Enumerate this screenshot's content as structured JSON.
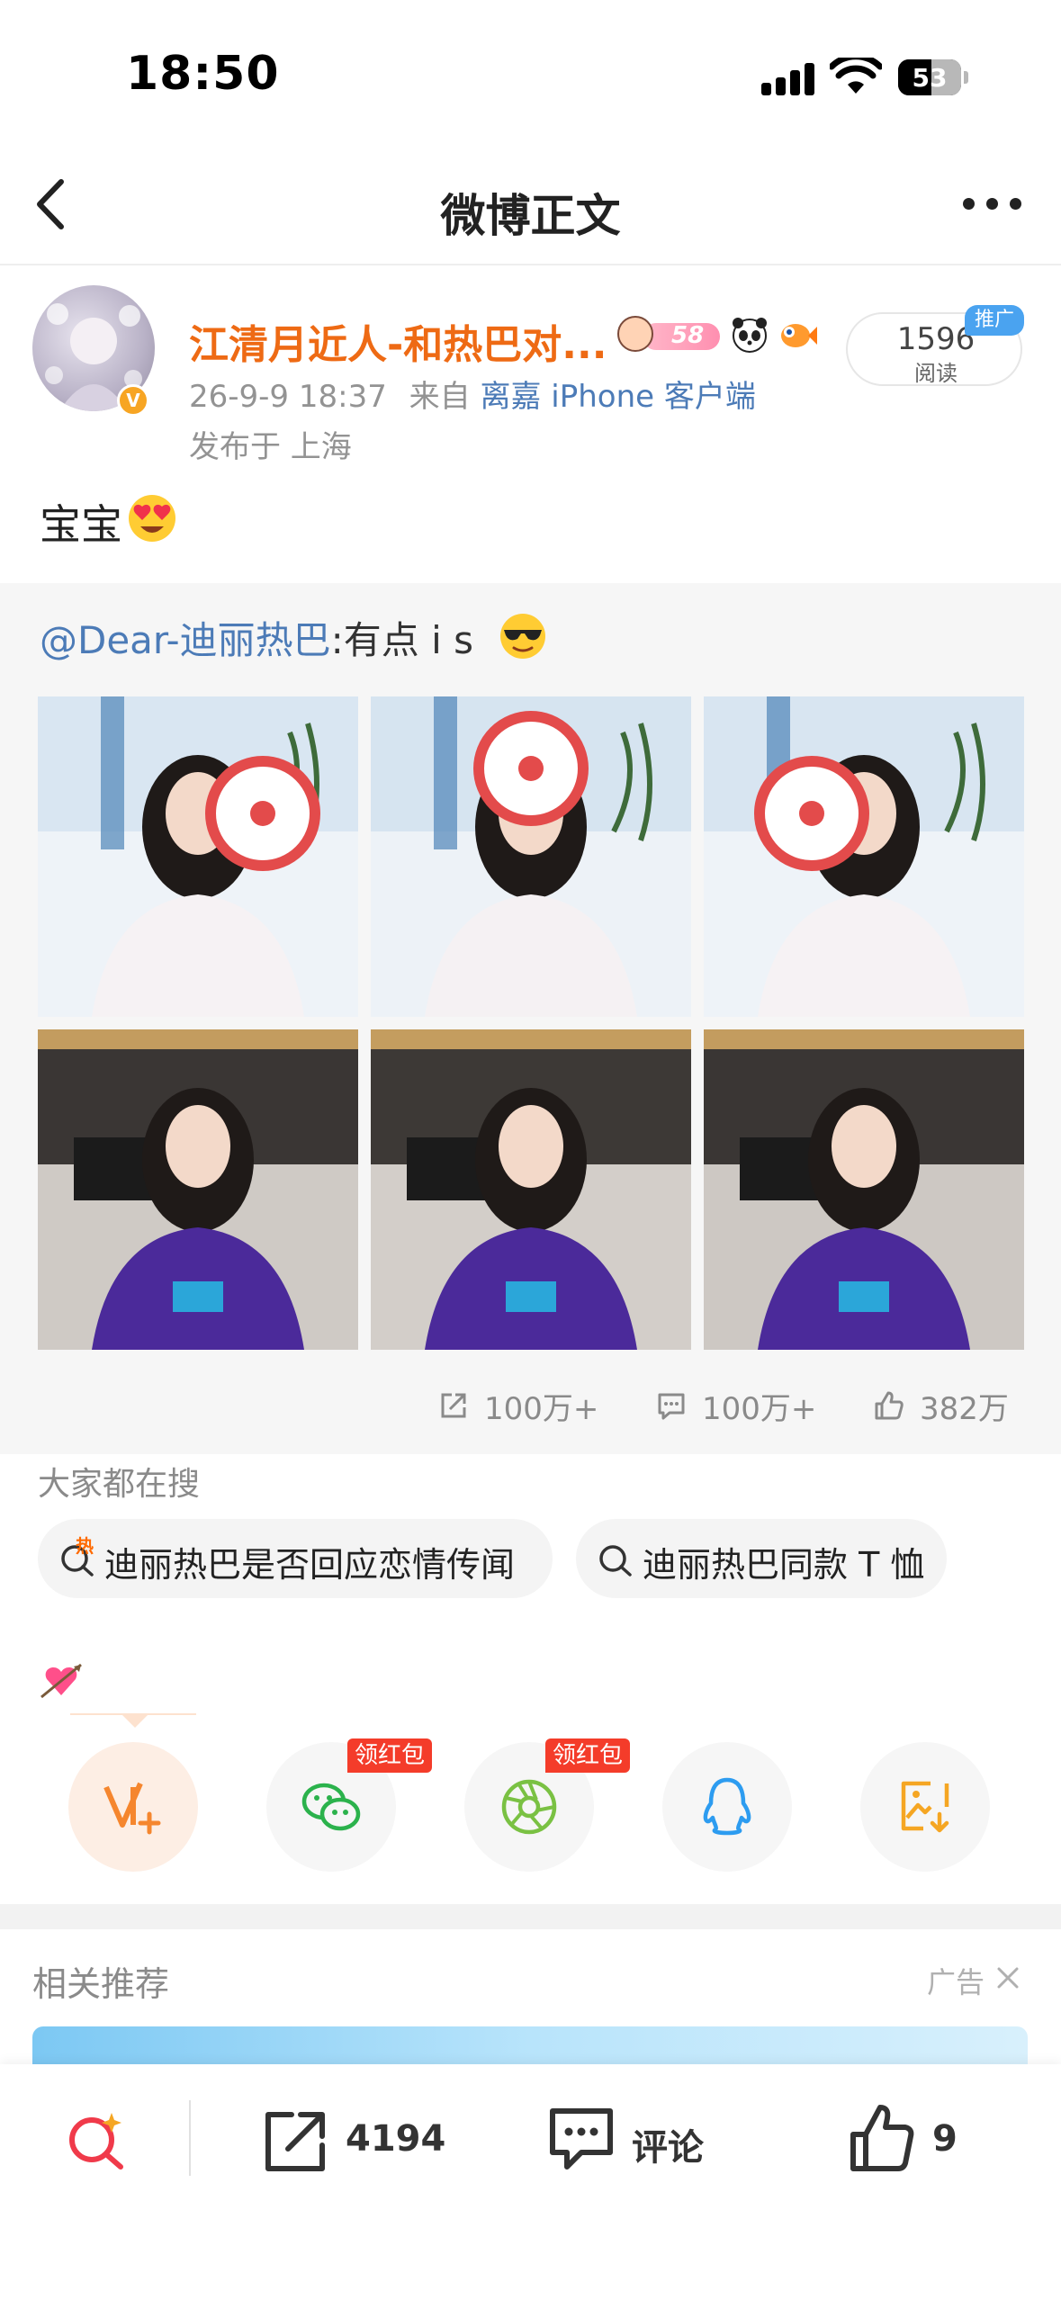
{
  "status_bar": {
    "time": "18:50",
    "battery": "53",
    "battery_level": 0.53
  },
  "nav": {
    "title": "微博正文"
  },
  "post": {
    "username": "江清月近人-和热巴对...",
    "level": "58",
    "date": "26-9-9 18:37",
    "from_prefix": "来自",
    "client": "离嘉 iPhone 客户端",
    "location": "发布于 上海",
    "read_count": "1596",
    "read_label": "阅读",
    "promo_tag": "推广",
    "text": "宝宝"
  },
  "repost": {
    "mention": "@Dear-迪丽热巴",
    "text": ":有点 i s",
    "photos": [
      {
        "name": "photo-1",
        "top": "#d9e6f2",
        "mid": "#eef3f8",
        "shirt": "#f6f2f4",
        "prop": "#e34b4b"
      },
      {
        "name": "photo-2",
        "top": "#d6e4f0",
        "mid": "#edf2f7",
        "shirt": "#f5f1f3",
        "prop": "#e34b4b"
      },
      {
        "name": "photo-3",
        "top": "#d8e5f1",
        "mid": "#eef3f8",
        "shirt": "#f6f2f4",
        "prop": "#e34b4b"
      },
      {
        "name": "photo-4",
        "top": "#3a3634",
        "mid": "#cfcac5",
        "shirt": "#4b2a9a",
        "prop": "#2ba6d9"
      },
      {
        "name": "photo-5",
        "top": "#3d3936",
        "mid": "#d3cec9",
        "shirt": "#4b2a9a",
        "prop": "#2ba6d9"
      },
      {
        "name": "photo-6",
        "top": "#3a3634",
        "mid": "#cdc8c3",
        "shirt": "#4b2a9a",
        "prop": "#2ba6d9"
      }
    ],
    "stats": {
      "reposts": "100万+",
      "comments": "100万+",
      "likes": "382万"
    }
  },
  "search": {
    "heading": "大家都在搜",
    "chips": [
      {
        "label": "迪丽热巴是否回应恋情传闻",
        "hot": "热"
      },
      {
        "label": "迪丽热巴同款 T 恤"
      }
    ]
  },
  "share": {
    "red_packet_label": "领红包",
    "buttons": [
      "fan-follow-icon",
      "wechat-icon",
      "moments-icon",
      "qq-icon",
      "save-image-icon"
    ]
  },
  "recommend": {
    "title": "相关推荐",
    "ad_label": "广告"
  },
  "bottom_bar": {
    "repost_count": "4194",
    "comment_label": "评论",
    "like_count": "9"
  },
  "colors": {
    "accent_orange": "#ee6a14",
    "link_blue": "#4c7bb7",
    "red_tag": "#f43c2a"
  }
}
